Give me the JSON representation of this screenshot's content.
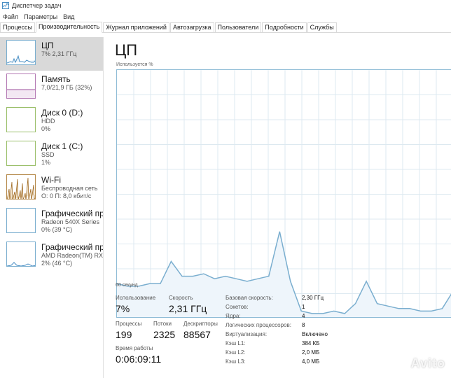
{
  "window": {
    "title": "Диспетчер задач"
  },
  "menu": [
    "Файл",
    "Параметры",
    "Вид"
  ],
  "tabs": [
    "Процессы",
    "Производительность",
    "Журнал приложений",
    "Автозагрузка",
    "Пользователи",
    "Подробности",
    "Службы"
  ],
  "sidebar": {
    "items": [
      {
        "title": "ЦП",
        "line1": "7% 2,31 ГГц",
        "line2": ""
      },
      {
        "title": "Память",
        "line1": "7,0/21,9 ГБ (32%)",
        "line2": ""
      },
      {
        "title": "Диск 0 (D:)",
        "line1": "HDD",
        "line2": "0%"
      },
      {
        "title": "Диск 1 (C:)",
        "line1": "SSD",
        "line2": "1%"
      },
      {
        "title": "Wi-Fi",
        "line1": "Беспроводная сеть",
        "line2": "О: 0 П: 8,0 кбит/с"
      },
      {
        "title": "Графический про",
        "line1": "Radeon 540X Series",
        "line2": "0% (39 °C)"
      },
      {
        "title": "Графический про",
        "line1": "AMD Radeon(TM) RX V",
        "line2": "2% (46 °C)"
      }
    ]
  },
  "main": {
    "title": "ЦП",
    "axis_label": "Используется %",
    "time_label": "60 секунд"
  },
  "stats": {
    "usage_label": "Использование",
    "usage_value": "7%",
    "speed_label": "Скорость",
    "speed_value": "2,31 ГГц",
    "processes_label": "Процессы",
    "processes_value": "199",
    "threads_label": "Потоки",
    "threads_value": "2325",
    "handles_label": "Дескрипторы",
    "handles_value": "88567",
    "uptime_label": "Время работы",
    "uptime_value": "0:06:09:11"
  },
  "specs": [
    {
      "label": "Базовая скорость:",
      "value": "2,30 ГГц"
    },
    {
      "label": "Сокетов:",
      "value": "1"
    },
    {
      "label": "Ядра:",
      "value": "4"
    },
    {
      "label": "Логических процессоров:",
      "value": "8"
    },
    {
      "label": "Виртуализация:",
      "value": "Включено"
    },
    {
      "label": "Кэш L1:",
      "value": "384 КБ"
    },
    {
      "label": "Кэш L2:",
      "value": "2,0 МБ"
    },
    {
      "label": "Кэш L3:",
      "value": "4,0 МБ"
    }
  ],
  "watermark": "Avito",
  "cpu_history": [
    14,
    13,
    13,
    14,
    14,
    23,
    17,
    17,
    18,
    16,
    17,
    16,
    15,
    16,
    17,
    35,
    15,
    3,
    2,
    2,
    3,
    2,
    6,
    15,
    6,
    5,
    4,
    4,
    3,
    3,
    4,
    11
  ],
  "colors": {
    "accent": "#8fbcd6",
    "line": "#7aaecf",
    "fill": "#eef5fb",
    "grid": "#dde9f0",
    "selected": "#d9d9d9"
  }
}
